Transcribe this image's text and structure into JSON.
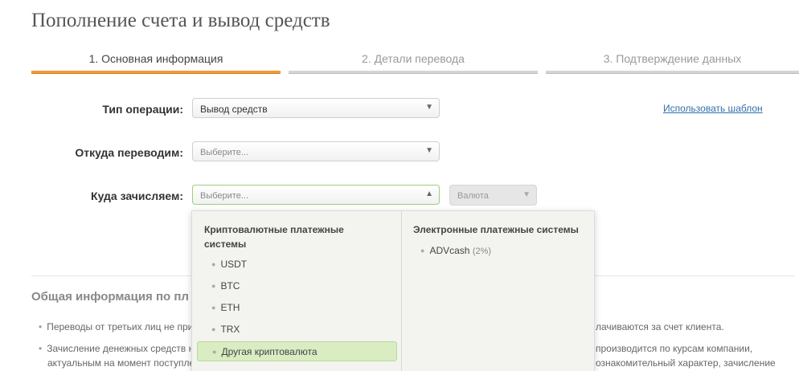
{
  "page": {
    "title": "Пополнение счета и вывод средств"
  },
  "steps": [
    {
      "label": "1. Основная информация"
    },
    {
      "label": "2. Детали перевода"
    },
    {
      "label": "3. Подтверждение данных"
    }
  ],
  "form": {
    "operation_type": {
      "label": "Тип операции:",
      "value": "Вывод средств"
    },
    "from": {
      "label": "Откуда переводим:",
      "placeholder": "Выберите..."
    },
    "to": {
      "label": "Куда зачисляем:",
      "placeholder": "Выберите..."
    },
    "currency": {
      "placeholder": "Валюта"
    },
    "use_template_link": "Использовать шаблон"
  },
  "dropdown": {
    "crypto": {
      "heading_line1": "Криптовалютные платежные",
      "heading_line2": "системы",
      "items": [
        "USDT",
        "BTC",
        "ETH",
        "TRX",
        "Другая криптовалюта"
      ],
      "highlighted": "Другая криптовалюта"
    },
    "electronic": {
      "heading": "Электронные платежные системы",
      "items": [
        {
          "name": "ADVcash",
          "fee": "(2%)"
        }
      ]
    }
  },
  "info": {
    "title": "Общая информация по пл",
    "line1_left": "Переводы от третьих лиц не при",
    "line1_right": "лачиваются за счет клиента.",
    "line2_left": "Зачисление денежных средств н",
    "line2_right": "производится по курсам компании,",
    "line3_left": "актуальным на момент поступле",
    "line3_right": "ознакомительный характер, зачисление"
  },
  "colors": {
    "accent": "#f29a38",
    "link": "#2f6fae",
    "highlight": "#d9ecc2"
  }
}
